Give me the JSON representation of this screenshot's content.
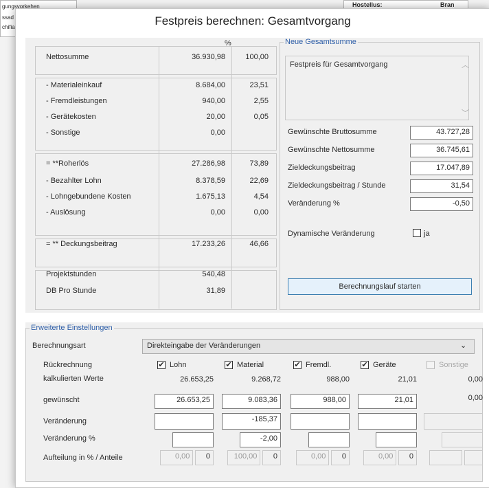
{
  "bg": {
    "lines": [
      "gungsvorkehen",
      "ssad",
      "chifia"
    ],
    "right_label1": "Hostellus:",
    "right_label2": "Bran"
  },
  "dialog": {
    "title": "Festpreis berechnen: Gesamtvorgang"
  },
  "summary": {
    "percent_header": "%",
    "rows": [
      {
        "label": "Nettosumme",
        "value": "36.930,98",
        "pct": "100,00"
      },
      {
        "label": "- Materialeinkauf",
        "value": "8.684,00",
        "pct": "23,51"
      },
      {
        "label": "- Fremdleistungen",
        "value": "940,00",
        "pct": "2,55"
      },
      {
        "label": "- Gerätekosten",
        "value": "20,00",
        "pct": "0,05"
      },
      {
        "label": "- Sonstige",
        "value": "0,00",
        "pct": ""
      },
      {
        "label": "= **Roherlös",
        "value": "27.286,98",
        "pct": "73,89"
      },
      {
        "label": "- Bezahlter Lohn",
        "value": "8.378,59",
        "pct": "22,69"
      },
      {
        "label": "- Lohngebundene Kosten",
        "value": "1.675,13",
        "pct": "4,54"
      },
      {
        "label": "- Auslösung",
        "value": "0,00",
        "pct": "0,00"
      },
      {
        "label": "= ** Deckungsbeitrag",
        "value": "17.233,26",
        "pct": "46,66"
      },
      {
        "label": "Projektstunden",
        "value": "540,48",
        "pct": ""
      },
      {
        "label": "DB Pro Stunde",
        "value": "31,89",
        "pct": ""
      }
    ]
  },
  "neue": {
    "legend": "Neue Gesamtsumme",
    "memo": "Festpreis für Gesamtvorgang",
    "fields": [
      {
        "label": "Gewünschte Bruttosumme",
        "value": "43.727,28"
      },
      {
        "label": "Gewünschte Nettosumme",
        "value": "36.745,61"
      },
      {
        "label": "Zieldeckungsbeitrag",
        "value": "17.047,89"
      },
      {
        "label": "Zieldeckungsbeitrag / Stunde",
        "value": "31,54"
      },
      {
        "label": "Veränderung %",
        "value": "-0,50"
      }
    ],
    "dynamic_label": "Dynamische Veränderung",
    "dynamic_ja": "ja",
    "start_button": "Berechnungslauf starten"
  },
  "erweitert": {
    "legend": "Erweiterte Einstellungen",
    "berechnungsart_label": "Berechnungsart",
    "berechnungsart_value": "Direkteingabe der Veränderungen",
    "row_labels": [
      "Rückrechnung",
      "kalkulierten Werte",
      "gewünscht",
      "Veränderung",
      "Veränderung %",
      "Aufteilung in % / Anteile"
    ],
    "cols": [
      {
        "label": "Lohn",
        "check": "✔",
        "kalk": "26.653,25",
        "gew": "26.653,25",
        "ver": "",
        "verpct": "",
        "auf_pct": "0,00",
        "auf_ant": "0"
      },
      {
        "label": "Material",
        "check": "✔",
        "kalk": "9.268,72",
        "gew": "9.083,36",
        "ver": "-185,37",
        "verpct": "-2,00",
        "auf_pct": "100,00",
        "auf_ant": "0"
      },
      {
        "label": "Fremdl.",
        "check": "✔",
        "kalk": "988,00",
        "gew": "988,00",
        "ver": "",
        "verpct": "",
        "auf_pct": "0,00",
        "auf_ant": "0"
      },
      {
        "label": "Geräte",
        "check": "✔",
        "kalk": "21,01",
        "gew": "21,01",
        "ver": "",
        "verpct": "",
        "auf_pct": "0,00",
        "auf_ant": "0"
      },
      {
        "label": "Sonstige",
        "check": "",
        "kalk": "0,00",
        "gew": "0,00",
        "ver": "",
        "verpct": "",
        "auf_pct": "",
        "auf_ant": ""
      }
    ]
  }
}
